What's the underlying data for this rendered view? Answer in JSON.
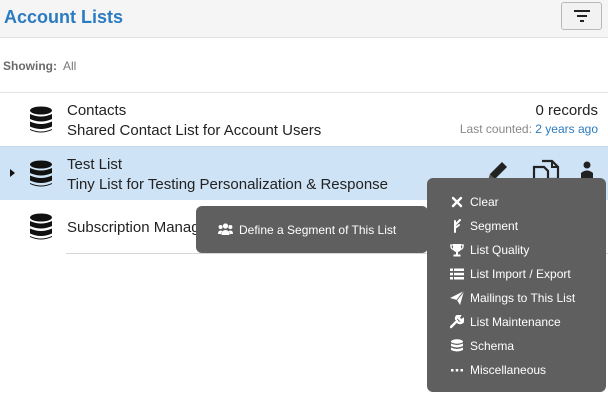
{
  "header": {
    "title": "Account Lists",
    "filter_icon": "filter-icon"
  },
  "filter": {
    "label": "Showing:",
    "value": "All"
  },
  "lists": [
    {
      "name": "Contacts",
      "description": "Shared Contact List for Account Users",
      "records": "0 records",
      "last_counted_label": "Last counted:",
      "last_counted_value": "2 years ago"
    },
    {
      "name": "Test List",
      "description": "Tiny List for Testing Personalization & Response",
      "selected": true
    },
    {
      "name": "Subscription Manag"
    }
  ],
  "tooltip": {
    "text": "Define a Segment of This List",
    "icon": "users-icon"
  },
  "menu": {
    "items": [
      {
        "label": "Clear",
        "icon": "close-icon"
      },
      {
        "label": "Segment",
        "icon": "segment-icon"
      },
      {
        "label": "List Quality",
        "icon": "trophy-icon"
      },
      {
        "label": "List Import / Export",
        "icon": "list-icon"
      },
      {
        "label": "Mailings to This List",
        "icon": "paper-plane-icon"
      },
      {
        "label": "List Maintenance",
        "icon": "wrench-icon"
      },
      {
        "label": "Schema",
        "icon": "database-icon"
      },
      {
        "label": "Miscellaneous",
        "icon": "ellipsis-icon"
      }
    ]
  },
  "colors": {
    "accent": "#2b7bc0",
    "selected_row": "#cfe3f6",
    "menu_bg": "#5f5f5f"
  }
}
